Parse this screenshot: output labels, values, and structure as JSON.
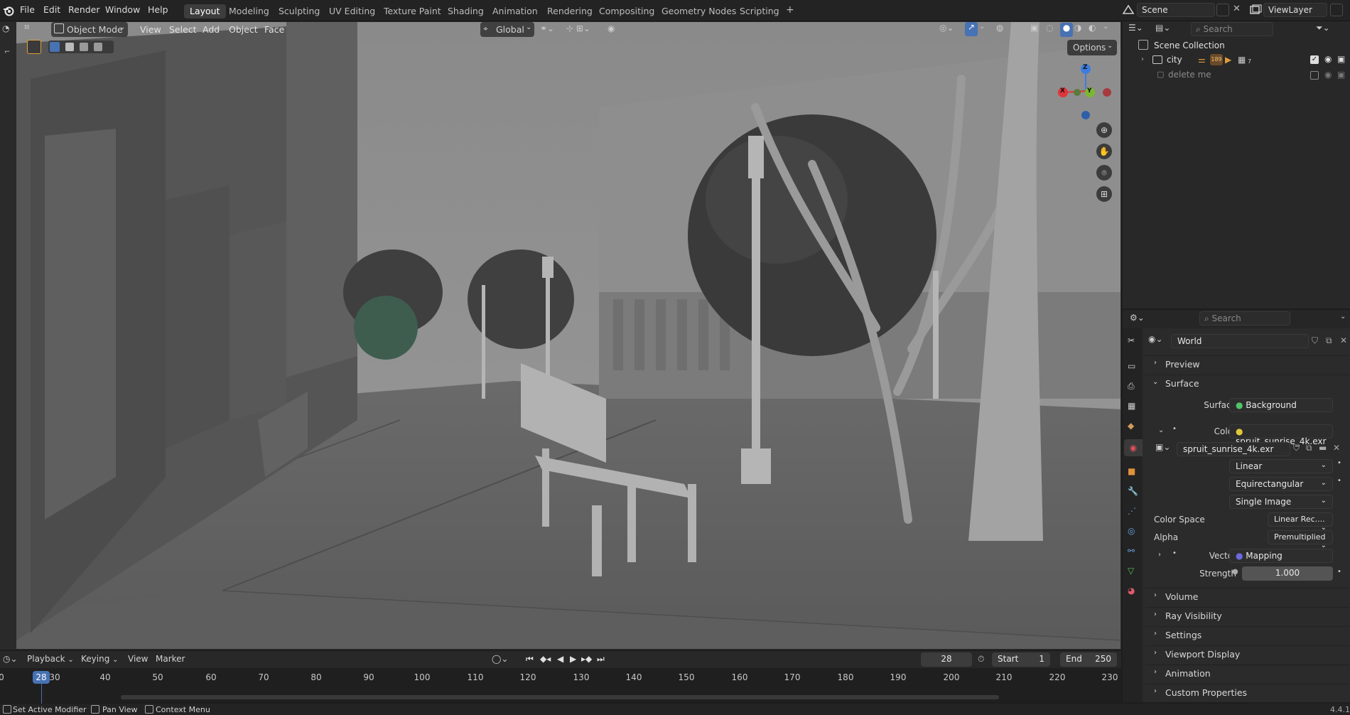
{
  "topbar": {
    "menus": [
      "File",
      "Edit",
      "Render",
      "Window",
      "Help"
    ],
    "workspaces": [
      "Layout",
      "Modeling",
      "Sculpting",
      "UV Editing",
      "Texture Paint",
      "Shading",
      "Animation",
      "Rendering",
      "Compositing",
      "Geometry Nodes",
      "Scripting"
    ],
    "active_workspace": "Layout",
    "add_tab": "+",
    "scene": "Scene",
    "view_layer": "ViewLayer"
  },
  "viewport": {
    "mode": "Object Mode",
    "menus": [
      "View",
      "Select",
      "Add",
      "Object",
      "Face"
    ],
    "orientation": "Global",
    "options": "Options",
    "gizmo": {
      "x": "X",
      "y": "Y",
      "z": "Z"
    }
  },
  "outliner": {
    "search_placeholder": "Search",
    "root": "Scene Collection",
    "items": [
      {
        "label": "city",
        "count": "189",
        "extra": "7"
      },
      {
        "label": "delete me"
      }
    ]
  },
  "properties": {
    "search_placeholder": "Search",
    "world_name": "World",
    "panels": {
      "preview": "Preview",
      "surface": "Surface",
      "volume": "Volume",
      "ray_visibility": "Ray Visibility",
      "settings": "Settings",
      "viewport_display": "Viewport Display",
      "animation": "Animation",
      "custom_properties": "Custom Properties"
    },
    "surface": {
      "surface_label": "Surface",
      "surface_value": "Background",
      "color_label": "Color",
      "color_value": "spruit_sunrise_4k.exr",
      "image_name": "spruit_sunrise_4k.exr",
      "interpolation": "Linear",
      "projection": "Equirectangular",
      "source": "Single Image",
      "color_space_label": "Color Space",
      "color_space_value": "Linear Rec....",
      "alpha_label": "Alpha",
      "alpha_value": "Premultiplied",
      "vector_label": "Vector",
      "vector_value": "Mapping",
      "strength_label": "Strength",
      "strength_value": "1.000"
    }
  },
  "timeline": {
    "menus": [
      "Playback",
      "Keying",
      "View",
      "Marker"
    ],
    "current_frame": "28",
    "start_label": "Start",
    "start_value": "1",
    "end_label": "End",
    "end_value": "250",
    "ruler_ticks": [
      "0",
      "30",
      "40",
      "50",
      "60",
      "70",
      "80",
      "90",
      "100",
      "110",
      "120",
      "130",
      "140",
      "150",
      "160",
      "170",
      "180",
      "190",
      "200",
      "210",
      "220",
      "230"
    ],
    "playhead": "28"
  },
  "statusbar": {
    "items": [
      "Set Active Modifier",
      "Pan View",
      "Context Menu"
    ],
    "version": "4.4.1"
  },
  "colors": {
    "accent": "#4772b3",
    "playhead": "#4772b3",
    "x_axis": "#e0353a",
    "y_axis": "#7ab82f",
    "z_axis": "#3d7de0"
  }
}
